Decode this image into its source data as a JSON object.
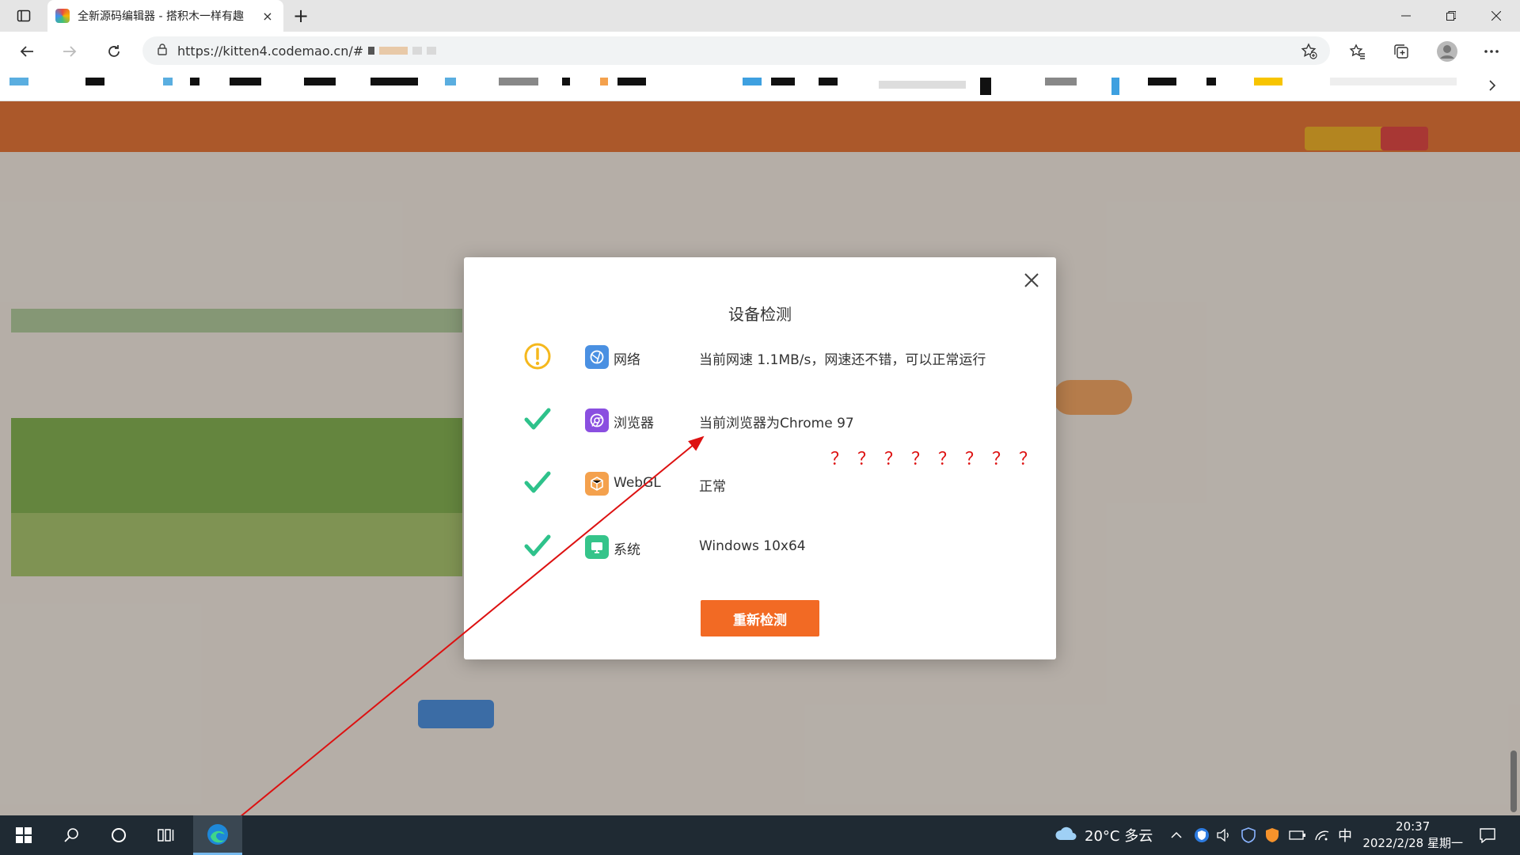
{
  "browser": {
    "tab_title": "全新源码编辑器 - 搭积木一样有趣",
    "tab_close": "×",
    "new_tab": "+",
    "url": "https://kitten4.codemao.cn/#",
    "icons": [
      "sidebar-toggle-icon",
      "favicon",
      "close-icon",
      "plus-icon",
      "minimize-icon",
      "maximize-icon",
      "close-window-icon",
      "back-icon",
      "forward-icon",
      "refresh-icon",
      "lock-icon",
      "add-favorite-icon",
      "favorites-icon",
      "collections-icon",
      "profile-icon",
      "more-icon",
      "chevron-right-icon"
    ]
  },
  "dialog": {
    "title": "设备检测",
    "rows": [
      {
        "status": "warning",
        "label": "网络",
        "result": "当前网速 1.1MB/s，网速还不错，可以正常运行",
        "color": "#4a90e2"
      },
      {
        "status": "ok",
        "label": "浏览器",
        "result": "当前浏览器为Chrome 97",
        "color": "#8a4fe0"
      },
      {
        "status": "ok",
        "label": "WebGL",
        "result": "正常",
        "color": "#f4a14d"
      },
      {
        "status": "ok",
        "label": "系统",
        "result": "Windows 10x64",
        "color": "#35c48a"
      }
    ],
    "button": "重新检测",
    "accent": "#f26a24",
    "warning_color": "#f5b81d",
    "ok_color": "#2ec28b"
  },
  "annotation": {
    "question_marks": "？？？？？？？？",
    "color": "#d11111"
  },
  "taskbar": {
    "weather": "20°C  多云",
    "ime": "中",
    "time": "20:37",
    "date": "2022/2/28 星期一"
  }
}
